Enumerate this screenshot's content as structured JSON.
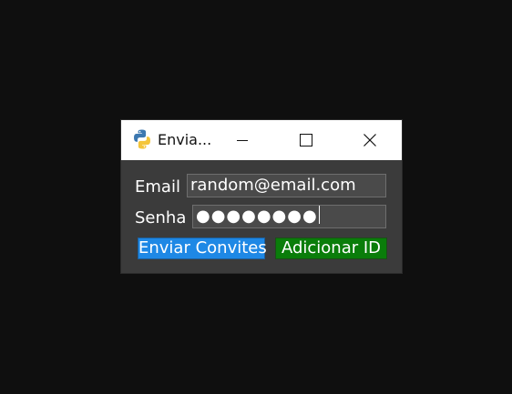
{
  "window": {
    "title": "Envia...",
    "icon": "python-icon",
    "controls": [
      "minimize-icon",
      "maximize-icon",
      "close-icon"
    ]
  },
  "form": {
    "email_label": "Email",
    "email_value": "random@email.com",
    "password_label": "Senha",
    "password_value": "●●●●●●●●"
  },
  "buttons": {
    "send_label": "Enviar Convites",
    "send_color": "#1e88e5",
    "add_label": "Adicionar ID",
    "add_color": "#0a7d0a"
  },
  "colors": {
    "desktop": "#0f0f0f",
    "window_body": "#3b3b3b",
    "field_bg": "#4a4a4a"
  }
}
